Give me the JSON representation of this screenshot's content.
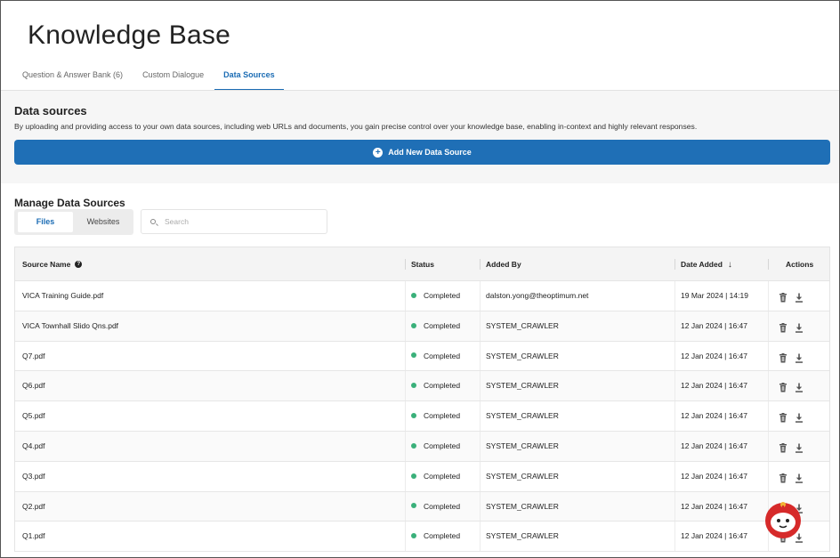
{
  "page": {
    "title": "Knowledge Base"
  },
  "tabs": [
    {
      "label": "Question & Answer Bank (6)",
      "active": false
    },
    {
      "label": "Custom Dialogue",
      "active": false
    },
    {
      "label": "Data Sources",
      "active": true
    }
  ],
  "data_sources": {
    "title": "Data sources",
    "description": "By uploading and providing access to your own data sources, including web URLs and documents, you gain precise control over your knowledge base, enabling in-context and highly relevant responses.",
    "add_button_label": "Add New Data Source"
  },
  "manage": {
    "title": "Manage Data Sources",
    "segments": [
      "Files",
      "Websites"
    ],
    "active_segment": "Files",
    "search_placeholder": "Search"
  },
  "table": {
    "columns": {
      "source_name": "Source Name",
      "status": "Status",
      "added_by": "Added By",
      "date_added": "Date Added",
      "actions": "Actions"
    },
    "sort": {
      "column": "Date Added",
      "direction": "descending"
    },
    "rows": [
      {
        "name": "VICA Training Guide.pdf",
        "status": "Completed",
        "added_by": "dalston.yong@theoptimum.net",
        "date": "19 Mar 2024 | 14:19"
      },
      {
        "name": "VICA Townhall Slido Qns.pdf",
        "status": "Completed",
        "added_by": "SYSTEM_CRAWLER",
        "date": "12 Jan 2024 | 16:47"
      },
      {
        "name": "Q7.pdf",
        "status": "Completed",
        "added_by": "SYSTEM_CRAWLER",
        "date": "12 Jan 2024 | 16:47"
      },
      {
        "name": "Q6.pdf",
        "status": "Completed",
        "added_by": "SYSTEM_CRAWLER",
        "date": "12 Jan 2024 | 16:47"
      },
      {
        "name": "Q5.pdf",
        "status": "Completed",
        "added_by": "SYSTEM_CRAWLER",
        "date": "12 Jan 2024 | 16:47"
      },
      {
        "name": "Q4.pdf",
        "status": "Completed",
        "added_by": "SYSTEM_CRAWLER",
        "date": "12 Jan 2024 | 16:47"
      },
      {
        "name": "Q3.pdf",
        "status": "Completed",
        "added_by": "SYSTEM_CRAWLER",
        "date": "12 Jan 2024 | 16:47"
      },
      {
        "name": "Q2.pdf",
        "status": "Completed",
        "added_by": "SYSTEM_CRAWLER",
        "date": "12 Jan 2024 | 16:47"
      },
      {
        "name": "Q1.pdf",
        "status": "Completed",
        "added_by": "SYSTEM_CRAWLER",
        "date": "12 Jan 2024 | 16:47"
      }
    ]
  },
  "icons": {
    "add": "plus-circle-icon",
    "search": "search-icon",
    "help": "question-circle-icon",
    "sort": "arrow-down-icon",
    "delete": "trash-icon",
    "download": "download-icon",
    "assistant": "chat-bot-icon"
  },
  "colors": {
    "primary": "#1f6fb6",
    "status_completed": "#3ab07a",
    "assistant": "#d62a2a"
  }
}
